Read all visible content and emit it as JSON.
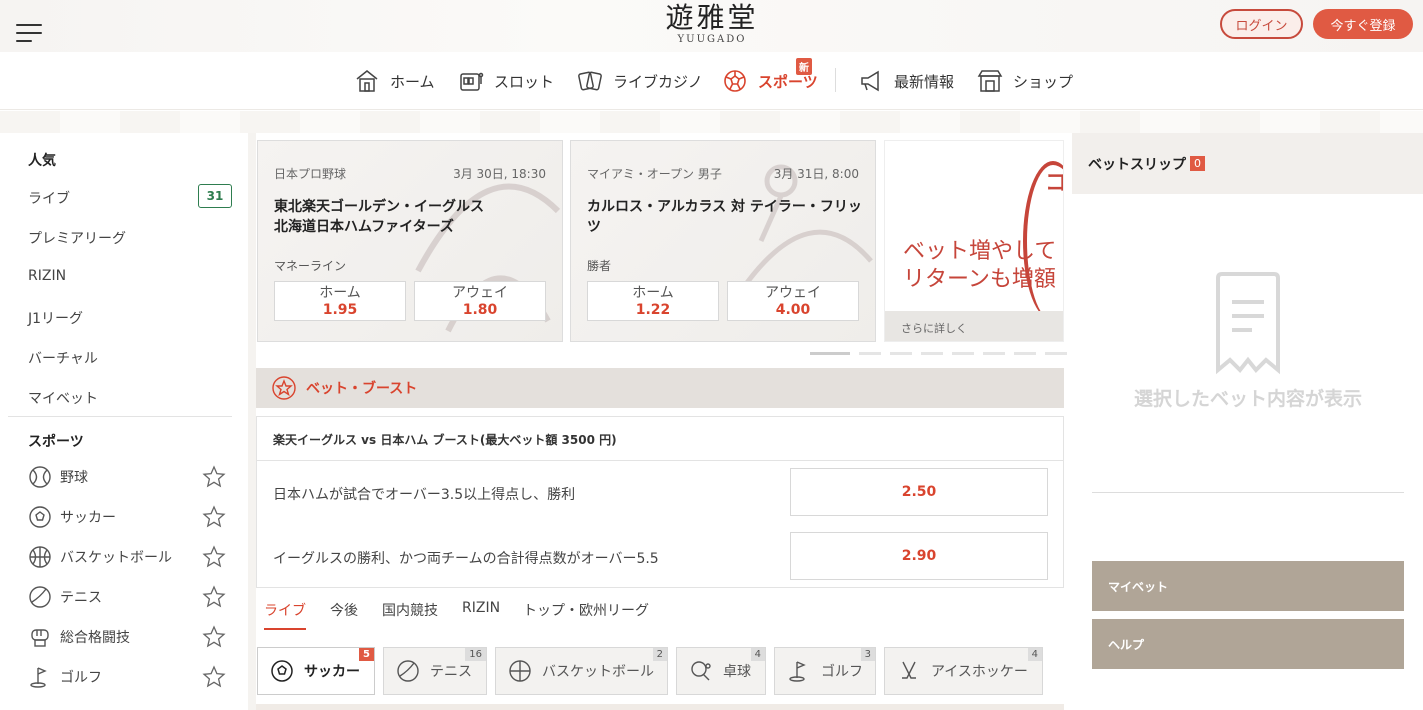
{
  "header": {
    "logo_main": "遊雅堂",
    "logo_sub": "YUUGADO",
    "login_label": "ログイン",
    "register_label": "今すぐ登録"
  },
  "nav": {
    "items": [
      {
        "label": "ホーム",
        "icon": "home-icon"
      },
      {
        "label": "スロット",
        "icon": "slot-machine-icon"
      },
      {
        "label": "ライブカジノ",
        "icon": "cards-icon"
      },
      {
        "label": "スポーツ",
        "icon": "soccer-ball-icon",
        "badge": "新"
      },
      {
        "label": "最新情報",
        "icon": "megaphone-icon"
      },
      {
        "label": "ショップ",
        "icon": "shop-icon"
      }
    ]
  },
  "sidebar": {
    "popular_heading": "人気",
    "popular": [
      {
        "label": "ライブ",
        "count": "31"
      },
      {
        "label": "プレミアリーグ"
      },
      {
        "label": "RIZIN"
      },
      {
        "label": "J1リーグ"
      },
      {
        "label": "バーチャル"
      },
      {
        "label": "マイベット"
      }
    ],
    "sports_heading": "スポーツ",
    "sports": [
      {
        "label": "野球",
        "icon": "baseball-icon"
      },
      {
        "label": "サッカー",
        "icon": "soccer-ball-icon"
      },
      {
        "label": "バスケットボール",
        "icon": "basketball-icon"
      },
      {
        "label": "テニス",
        "icon": "tennis-ball-icon"
      },
      {
        "label": "総合格闘技",
        "icon": "fist-icon"
      },
      {
        "label": "ゴルフ",
        "icon": "golf-icon"
      }
    ]
  },
  "cards": [
    {
      "league": "日本プロ野球",
      "time": "3月 30日, 18:30",
      "teams": "東北楽天ゴールデン・イーグルス\n北海道日本ハムファイターズ",
      "market": "マネーライン",
      "home_label": "ホーム",
      "home_odds": "1.95",
      "away_label": "アウェイ",
      "away_odds": "1.80"
    },
    {
      "league": "マイアミ・オープン 男子",
      "time": "3月 31日, 8:00",
      "teams": "カルロス・アルカラス 対 テイラー・フリッツ",
      "market": "勝者",
      "home_label": "ホーム",
      "home_odds": "1.22",
      "away_label": "アウェイ",
      "away_odds": "4.00"
    }
  ],
  "promo": {
    "line1": "ベット増やして",
    "line2": "リターンも増額",
    "more": "さらに詳しく",
    "accent": "コ"
  },
  "boost": {
    "heading": "ベット・ブースト",
    "title": "楽天イーグルス vs 日本ハム ブースト(最大ベット額 3500 円)",
    "rows": [
      {
        "text": "日本ハムが試合でオーバー3.5以上得点し、勝利",
        "odds": "2.50"
      },
      {
        "text": "イーグルスの勝利、かつ両チームの合計得点数がオーバー5.5",
        "odds": "2.90"
      }
    ]
  },
  "tabs": [
    "ライブ",
    "今後",
    "国内競技",
    "RIZIN",
    "トップ・欧州リーグ"
  ],
  "chips": [
    {
      "label": "サッカー",
      "count": "5",
      "icon": "soccer-ball-icon"
    },
    {
      "label": "テニス",
      "count": "16",
      "icon": "tennis-ball-icon"
    },
    {
      "label": "バスケットボール",
      "count": "2",
      "icon": "basketball-icon"
    },
    {
      "label": "卓球",
      "count": "4",
      "icon": "table-tennis-icon"
    },
    {
      "label": "ゴルフ",
      "count": "3",
      "icon": "golf-icon"
    },
    {
      "label": "アイスホッケー",
      "count": "4",
      "icon": "hockey-sticks-icon"
    }
  ],
  "betslip": {
    "title": "ベットスリップ",
    "count": "0",
    "empty_text": "選択したベット内容が表示",
    "buttons": [
      "マイベット",
      "ヘルプ"
    ]
  },
  "colors": {
    "accent": "#d9442e",
    "register": "#e05a43",
    "slip_button": "#b0a597",
    "live_badge": "#2e7d4f"
  }
}
